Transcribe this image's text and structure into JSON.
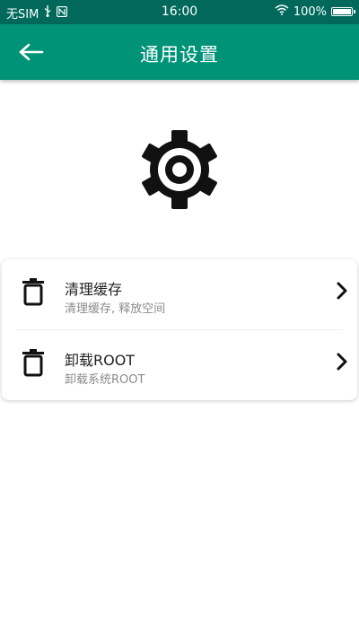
{
  "status_bar": {
    "carrier": "无SIM",
    "time": "16:00",
    "battery_percent": "100%",
    "battery_level": 1.0
  },
  "app_bar": {
    "title": "通用设置",
    "back_icon": "arrow-left-icon"
  },
  "hero": {
    "icon": "gear-icon"
  },
  "settings": [
    {
      "icon": "trash-icon",
      "title": "清理缓存",
      "subtitle": "清理缓存, 释放空间",
      "chevron_icon": "chevron-right-icon"
    },
    {
      "icon": "trash-icon",
      "title": "卸载ROOT",
      "subtitle": "卸载系统ROOT",
      "chevron_icon": "chevron-right-icon"
    }
  ],
  "colors": {
    "status_bar": "#00695c",
    "app_bar": "#009377",
    "title_text": "#222222",
    "subtitle_text": "#8a8a8a"
  }
}
